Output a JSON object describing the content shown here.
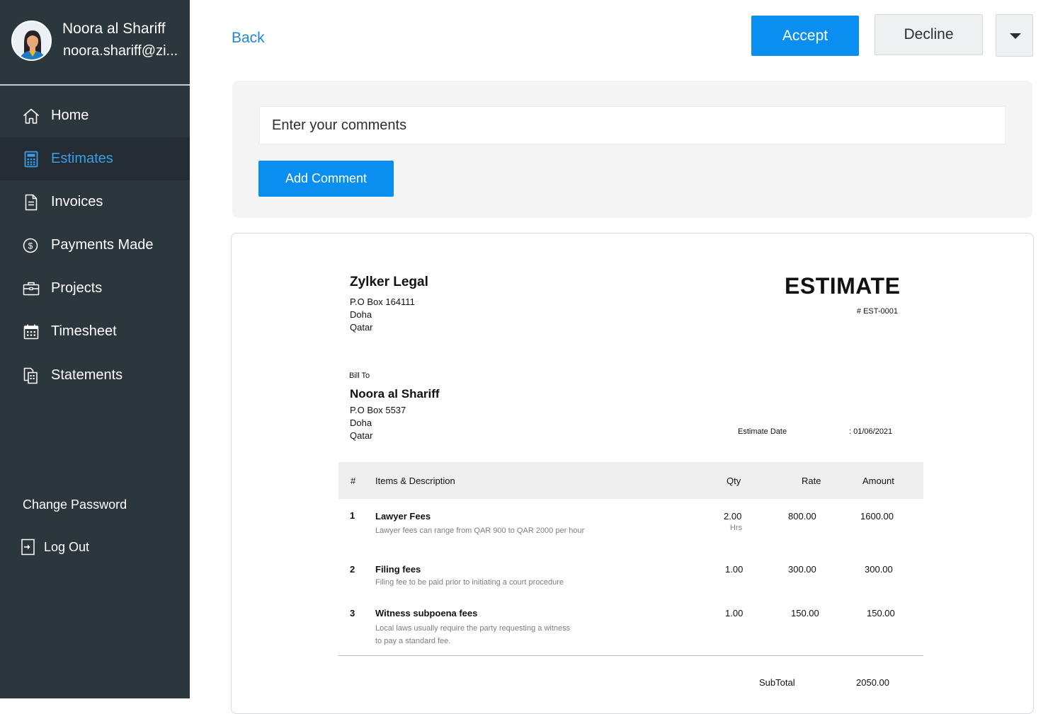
{
  "user": {
    "name": "Noora al Shariff",
    "email": "noora.shariff@zi..."
  },
  "sidebar": {
    "items": [
      {
        "label": "Home",
        "icon": "home-icon"
      },
      {
        "label": "Estimates",
        "icon": "calculator-icon",
        "active": true
      },
      {
        "label": "Invoices",
        "icon": "document-icon"
      },
      {
        "label": "Payments Made",
        "icon": "dollar-circle-icon"
      },
      {
        "label": "Projects",
        "icon": "briefcase-icon"
      },
      {
        "label": "Timesheet",
        "icon": "calendar-icon"
      },
      {
        "label": "Statements",
        "icon": "statement-icon"
      }
    ],
    "change_password": "Change Password",
    "log_out": "Log Out"
  },
  "toolbar": {
    "back": "Back",
    "accept": "Accept",
    "decline": "Decline"
  },
  "comments": {
    "placeholder": "Enter your comments",
    "add_button": "Add Comment"
  },
  "estimate": {
    "org_name": "Zylker Legal",
    "org_address": [
      "P.O Box 164111",
      "Doha",
      "Qatar"
    ],
    "title": "ESTIMATE",
    "number": "# EST-0001",
    "bill_to_label": "Bill To",
    "customer_name": "Noora al Shariff",
    "customer_address": [
      "P.O Box 5537",
      "Doha",
      "Qatar"
    ],
    "date_label": "Estimate Date",
    "date_value": ": 01/06/2021",
    "columns": {
      "num": "#",
      "desc": "Items & Description",
      "qty": "Qty",
      "rate": "Rate",
      "amount": "Amount"
    },
    "items": [
      {
        "num": "1",
        "name": "Lawyer Fees",
        "desc": [
          "Lawyer fees can range from QAR 900 to QAR 2000 per hour"
        ],
        "qty": "2.00",
        "unit": "Hrs",
        "rate": "800.00",
        "amount": "1600.00"
      },
      {
        "num": "2",
        "name": "Filing fees",
        "desc": [
          "Filing fee to be paid prior to initiating a court procedure"
        ],
        "qty": "1.00",
        "unit": "",
        "rate": "300.00",
        "amount": "300.00"
      },
      {
        "num": "3",
        "name": "Witness subpoena fees",
        "desc": [
          "Local laws usually require the party requesting a witness",
          "to pay a standard fee."
        ],
        "qty": "1.00",
        "unit": "",
        "rate": "150.00",
        "amount": "150.00"
      }
    ],
    "subtotal_label": "SubTotal",
    "subtotal_value": "2050.00"
  },
  "colors": {
    "sidebar_bg": "#2c363d",
    "sidebar_active_bg": "#232c32",
    "accent": "#0a8ff0",
    "active_text": "#3b9ee8",
    "link": "#1f86d9"
  }
}
